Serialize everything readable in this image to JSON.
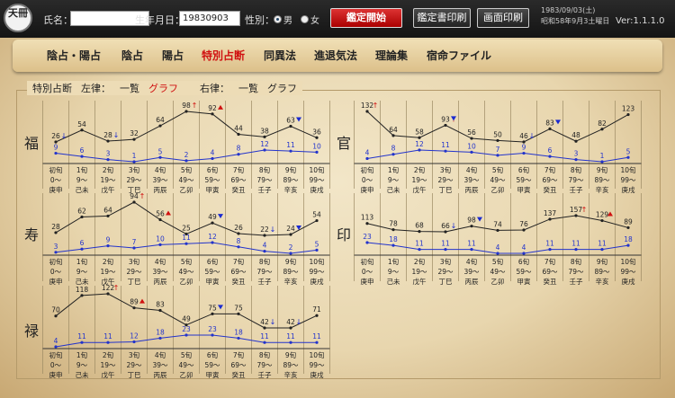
{
  "topbar": {
    "logo_text": "天冊",
    "name_label": "氏名：",
    "name_value": "",
    "birth_label": "生年月日：",
    "birth_value": "19830903",
    "sex_label": "性別：",
    "sex_male": "男",
    "sex_female": "女",
    "sex_selected": "男",
    "start_button": "鑑定開始",
    "print_report_button": "鑑定書印刷",
    "print_screen_button": "画面印刷",
    "date_line1": "1983/09/03(土)",
    "date_line2": "昭和58年9月3土曜日",
    "version": "Ver:1.1.1.0"
  },
  "menu": {
    "items": [
      "陰占・陽占",
      "陰占",
      "陽占",
      "特別占断",
      "同異法",
      "進退気法",
      "理論集",
      "宿命ファイル"
    ],
    "active": "特別占断"
  },
  "panel": {
    "title": "特別占断",
    "left_label": "左律：",
    "left_opt1": "一覧",
    "left_opt2": "グラフ",
    "right_label": "右律：",
    "right_opt1": "一覧",
    "right_opt2": "グラフ"
  },
  "columns": [
    {
      "name": "初旬",
      "age": "0〜",
      "kanshi": "庚申"
    },
    {
      "name": "1旬",
      "age": "9〜",
      "kanshi": "己未"
    },
    {
      "name": "2旬",
      "age": "19〜",
      "kanshi": "戊午"
    },
    {
      "name": "3旬",
      "age": "29〜",
      "kanshi": "丁巳"
    },
    {
      "name": "4旬",
      "age": "39〜",
      "kanshi": "丙辰"
    },
    {
      "name": "5旬",
      "age": "49〜",
      "kanshi": "乙卯"
    },
    {
      "name": "6旬",
      "age": "59〜",
      "kanshi": "甲寅"
    },
    {
      "name": "7旬",
      "age": "69〜",
      "kanshi": "癸丑"
    },
    {
      "name": "8旬",
      "age": "79〜",
      "kanshi": "壬子"
    },
    {
      "name": "9旬",
      "age": "89〜",
      "kanshi": "辛亥"
    },
    {
      "name": "10旬",
      "age": "99〜",
      "kanshi": "庚戌"
    }
  ],
  "chart_data": [
    {
      "type": "line",
      "label": "福",
      "series": [
        {
          "values": [
            26,
            54,
            28,
            32,
            64,
            98,
            92,
            44,
            38,
            63,
            36
          ],
          "color": "#222222"
        },
        {
          "values": [
            9,
            6,
            3,
            1,
            5,
            2,
            4,
            8,
            12,
            11,
            10
          ],
          "color": "#2233cc"
        }
      ],
      "markers": [
        {
          "i": 0,
          "t": "down-arrow"
        },
        {
          "i": 2,
          "t": "down-arrow"
        },
        {
          "i": 5,
          "t": "up-arrow"
        },
        {
          "i": 6,
          "t": "up-tri"
        },
        {
          "i": 9,
          "t": "down-tri"
        }
      ]
    },
    {
      "type": "line",
      "label": "官",
      "series": [
        {
          "values": [
            132,
            64,
            58,
            93,
            56,
            50,
            46,
            83,
            48,
            82,
            123
          ],
          "color": "#222222"
        },
        {
          "values": [
            4,
            8,
            12,
            11,
            10,
            7,
            9,
            6,
            3,
            1,
            5
          ],
          "color": "#2233cc"
        }
      ],
      "markers": [
        {
          "i": 0,
          "t": "up-arrow"
        },
        {
          "i": 3,
          "t": "up-arrow"
        },
        {
          "i": 3,
          "t": "down-tri"
        },
        {
          "i": 6,
          "t": "down-arrow"
        },
        {
          "i": 7,
          "t": "down-tri"
        }
      ]
    },
    {
      "type": "line",
      "label": "寿",
      "series": [
        {
          "values": [
            28,
            62,
            64,
            94,
            56,
            25,
            49,
            26,
            22,
            24,
            54
          ],
          "color": "#222222"
        },
        {
          "values": [
            3,
            6,
            9,
            7,
            10,
            11,
            12,
            8,
            4,
            2,
            5
          ],
          "color": "#2233cc"
        }
      ],
      "markers": [
        {
          "i": 3,
          "t": "up-arrow"
        },
        {
          "i": 4,
          "t": "up-tri"
        },
        {
          "i": 6,
          "t": "down-tri"
        },
        {
          "i": 8,
          "t": "down-arrow"
        },
        {
          "i": 9,
          "t": "down-tri"
        }
      ]
    },
    {
      "type": "line",
      "label": "印",
      "series": [
        {
          "values": [
            113,
            78,
            68,
            66,
            98,
            74,
            76,
            137,
            157,
            129,
            89
          ],
          "color": "#222222"
        },
        {
          "values": [
            23,
            18,
            11,
            11,
            11,
            4,
            4,
            11,
            11,
            11,
            18
          ],
          "color": "#2233cc"
        }
      ],
      "markers": [
        {
          "i": 3,
          "t": "down-arrow"
        },
        {
          "i": 4,
          "t": "down-tri"
        },
        {
          "i": 8,
          "t": "up-arrow"
        },
        {
          "i": 9,
          "t": "up-tri"
        }
      ]
    },
    {
      "type": "line",
      "label": "禄",
      "series": [
        {
          "values": [
            70,
            118,
            122,
            89,
            83,
            49,
            75,
            75,
            42,
            42,
            71
          ],
          "color": "#222222"
        },
        {
          "values": [
            4,
            11,
            11,
            12,
            18,
            23,
            23,
            18,
            11,
            11,
            11
          ],
          "color": "#2233cc"
        }
      ],
      "markers": [
        {
          "i": 2,
          "t": "up-arrow"
        },
        {
          "i": 3,
          "t": "up-tri"
        },
        {
          "i": 6,
          "t": "down-tri"
        },
        {
          "i": 8,
          "t": "down-arrow"
        },
        {
          "i": 9,
          "t": "down-arrow"
        }
      ]
    }
  ]
}
